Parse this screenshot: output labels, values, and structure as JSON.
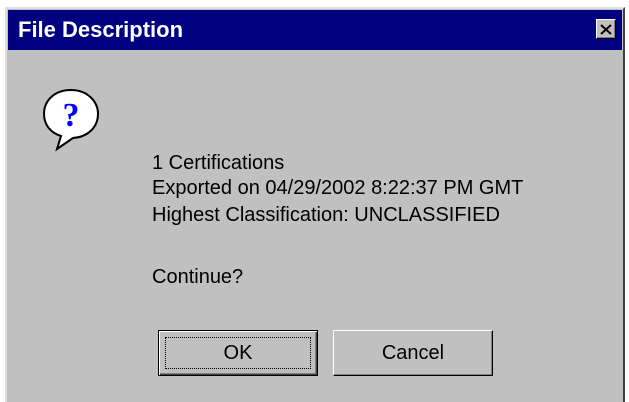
{
  "window": {
    "title": "File Description",
    "close_icon": "close-icon",
    "colors": {
      "titlebar": "#000080",
      "face": "#c0c0c0"
    }
  },
  "icon": {
    "name": "question-icon",
    "glyph": "?"
  },
  "message": {
    "line1": "1 Certifications",
    "line2": "Exported on 04/29/2002 8:22:37 PM GMT",
    "line3": "Highest Classification: UNCLASSIFIED",
    "prompt": "Continue?"
  },
  "buttons": {
    "ok_label": "OK",
    "cancel_label": "Cancel"
  }
}
